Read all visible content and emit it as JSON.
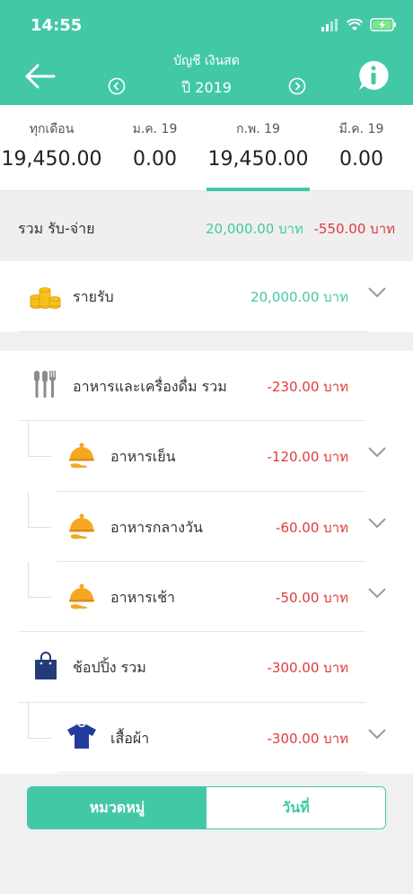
{
  "status": {
    "time": "14:55"
  },
  "header": {
    "title": "บัญชี เงินสด",
    "year": "ปี 2019"
  },
  "months": [
    {
      "label": "ทุกเดือน",
      "value": "19,450.00"
    },
    {
      "label": "ม.ค. 19",
      "value": "0.00"
    },
    {
      "label": "ก.พ. 19",
      "value": "19,450.00"
    },
    {
      "label": "มี.ค. 19",
      "value": "0.00"
    }
  ],
  "summary": {
    "label": "รวม รับ-จ่าย",
    "income": "20,000.00 บาท",
    "expense": "-550.00 บาท"
  },
  "income_row": {
    "label": "รายรับ",
    "amount": "20,000.00 บาท"
  },
  "categories": [
    {
      "label": "อาหารและเครื่องดื่ม รวม",
      "amount": "-230.00 บาท",
      "icon": "cutlery-icon"
    },
    {
      "label": "อาหารเย็น",
      "amount": "-120.00 บาท",
      "icon": "food-tray-icon"
    },
    {
      "label": "อาหารกลางวัน",
      "amount": "-60.00 บาท",
      "icon": "food-tray-icon"
    },
    {
      "label": "อาหารเช้า",
      "amount": "-50.00 บาท",
      "icon": "food-tray-icon"
    },
    {
      "label": "ช้อปปิ้ง รวม",
      "amount": "-300.00 บาท",
      "icon": "shopping-bag-icon"
    },
    {
      "label": "เสื้อผ้า",
      "amount": "-300.00 บาท",
      "icon": "shirt-icon"
    }
  ],
  "segments": {
    "left": "หมวดหมู่",
    "right": "วันที่"
  },
  "colors": {
    "accent": "#43c8a6",
    "negative": "#e03a3a"
  }
}
